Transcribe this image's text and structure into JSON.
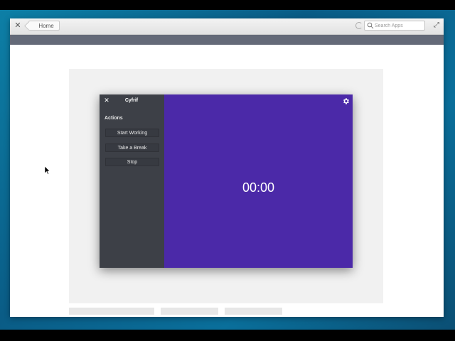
{
  "appcenter": {
    "close_icon": "close-icon",
    "home_label": "Home",
    "search_placeholder": "Search Apps",
    "maximize_icon": "maximize-icon"
  },
  "cyfrif": {
    "title": "Cyfrif",
    "close_icon": "close-icon",
    "actions_label": "Actions",
    "buttons": [
      "Start Working",
      "Take a Break",
      "Stop"
    ],
    "timer": "00:00",
    "settings_icon": "gear-icon",
    "colors": {
      "sidebar": "#3d4047",
      "main": "#4b29a8"
    }
  }
}
